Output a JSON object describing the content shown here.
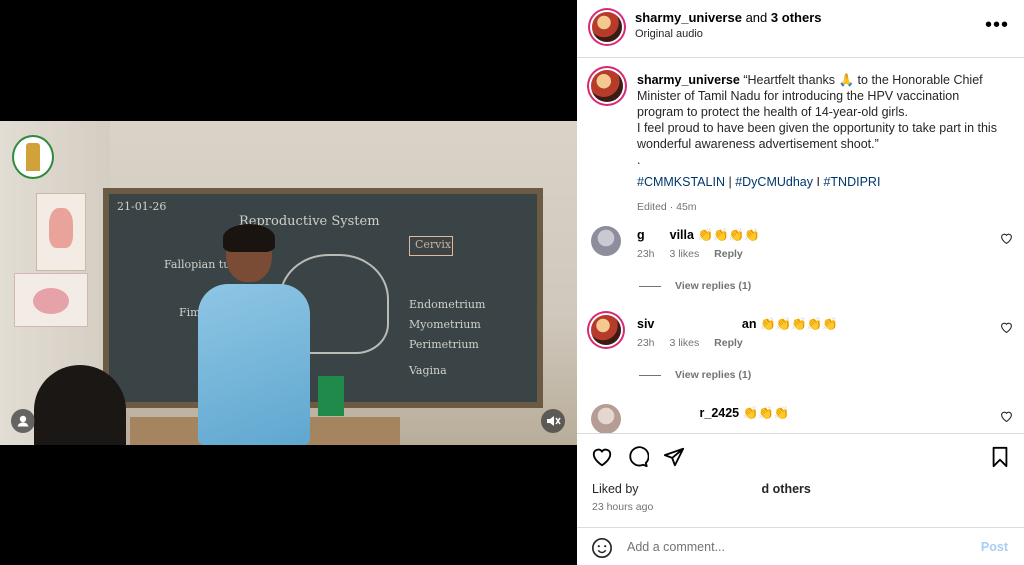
{
  "header": {
    "username": "sharmy_universe",
    "and_text": "and",
    "others": "3 others",
    "audio": "Original audio",
    "more": "•••"
  },
  "caption": {
    "username": "sharmy_universe",
    "line1": "“Heartfelt thanks 🙏 to the Honorable Chief Minister of Tamil Nadu for introducing the HPV vaccination program to protect the health of 14-year-old girls.",
    "line2": "I feel proud to have been given the opportunity to take part in this wonderful awareness advertisement shoot.”",
    "dot": ".",
    "tags": [
      "#CMMKSTALIN",
      "#DyCMUdhay",
      "#TNDIPRI"
    ],
    "sep1": "|",
    "sep2": "I",
    "meta": "Edited · 45m"
  },
  "comments": [
    {
      "username": "g  villa",
      "emoji": "👏👏👏👏",
      "time": "23h",
      "likes": "3 likes",
      "reply": "Reply",
      "view_replies": "View replies (1)"
    },
    {
      "username": "siv       an",
      "emoji": "👏👏👏👏👏",
      "time": "23h",
      "likes": "3 likes",
      "reply": "Reply",
      "view_replies": "View replies (1)"
    },
    {
      "username": "     r_2425",
      "emoji": "👏👏👏",
      "time": "",
      "likes": "",
      "reply": "",
      "view_replies": ""
    }
  ],
  "likes": {
    "prefix": "Liked by",
    "suffix": "d others"
  },
  "time": "23 hours ago",
  "add_comment": {
    "placeholder": "Add a comment...",
    "post": "Post"
  },
  "video": {
    "board_title": "Reproductive System",
    "board_date": "21-01-26",
    "labels": [
      "Fallopian tube",
      "Cervix",
      "Endometrium",
      "Myometrium",
      "Perimetrium",
      "Vagina",
      "Fimbriae"
    ]
  },
  "colors": {
    "link": "#00376b",
    "secondary": "#737373",
    "post_disabled": "#a9cdf6",
    "story_ring": "#d62976"
  }
}
